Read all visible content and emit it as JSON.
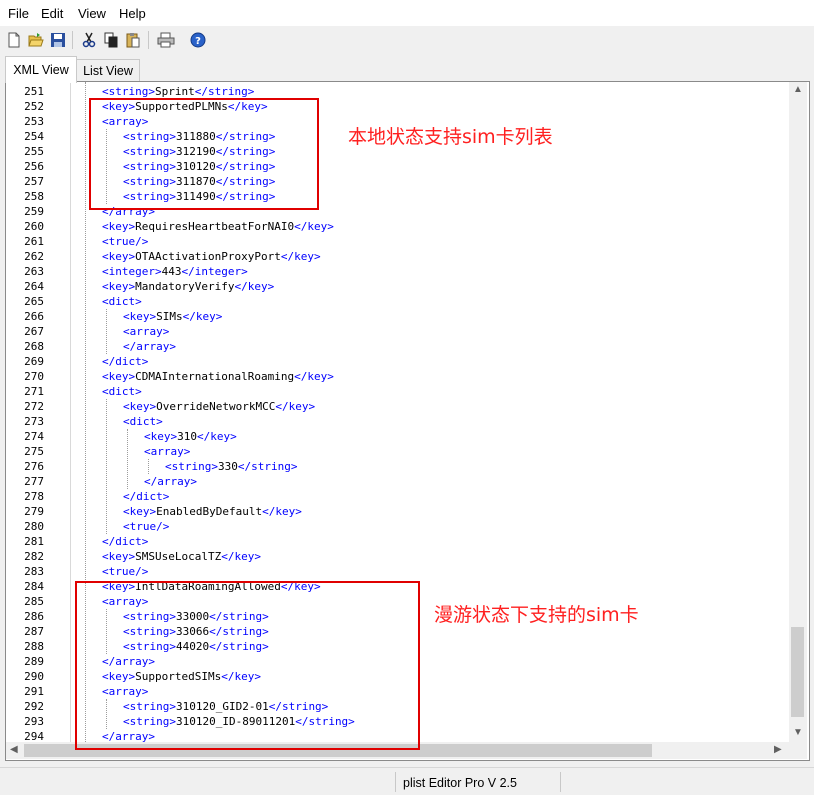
{
  "menu": [
    "File",
    "Edit",
    "View",
    "Help"
  ],
  "toolbar": {
    "icons": [
      "new-icon",
      "open-icon",
      "save-icon",
      "cut-icon",
      "copy-icon",
      "paste-icon",
      "print-icon",
      "help-icon"
    ]
  },
  "tabs": [
    {
      "label": "XML View",
      "active": true
    },
    {
      "label": "List View",
      "active": false
    }
  ],
  "editor": {
    "lines": [
      {
        "n": "251",
        "depth": 1,
        "code": "<string>Sprint</string>"
      },
      {
        "n": "252",
        "depth": 1,
        "code": "<key>SupportedPLMNs</key>"
      },
      {
        "n": "253",
        "depth": 1,
        "code": "<array>"
      },
      {
        "n": "254",
        "depth": 2,
        "code": "<string>311880</string>"
      },
      {
        "n": "255",
        "depth": 2,
        "code": "<string>312190</string>"
      },
      {
        "n": "256",
        "depth": 2,
        "code": "<string>310120</string>"
      },
      {
        "n": "257",
        "depth": 2,
        "code": "<string>311870</string>"
      },
      {
        "n": "258",
        "depth": 2,
        "code": "<string>311490</string>"
      },
      {
        "n": "259",
        "depth": 1,
        "code": "</array>"
      },
      {
        "n": "260",
        "depth": 1,
        "code": "<key>RequiresHeartbeatForNAI0</key>"
      },
      {
        "n": "261",
        "depth": 1,
        "code": "<true/>"
      },
      {
        "n": "262",
        "depth": 1,
        "code": "<key>OTAActivationProxyPort</key>"
      },
      {
        "n": "263",
        "depth": 1,
        "code": "<integer>443</integer>"
      },
      {
        "n": "264",
        "depth": 1,
        "code": "<key>MandatoryVerify</key>"
      },
      {
        "n": "265",
        "depth": 1,
        "code": "<dict>"
      },
      {
        "n": "266",
        "depth": 2,
        "code": "<key>SIMs</key>"
      },
      {
        "n": "267",
        "depth": 2,
        "code": "<array>"
      },
      {
        "n": "268",
        "depth": 2,
        "code": "</array>"
      },
      {
        "n": "269",
        "depth": 1,
        "code": "</dict>"
      },
      {
        "n": "270",
        "depth": 1,
        "code": "<key>CDMAInternationalRoaming</key>"
      },
      {
        "n": "271",
        "depth": 1,
        "code": "<dict>"
      },
      {
        "n": "272",
        "depth": 2,
        "code": "<key>OverrideNetworkMCC</key>"
      },
      {
        "n": "273",
        "depth": 2,
        "code": "<dict>"
      },
      {
        "n": "274",
        "depth": 3,
        "code": "<key>310</key>"
      },
      {
        "n": "275",
        "depth": 3,
        "code": "<array>"
      },
      {
        "n": "276",
        "depth": 4,
        "code": "<string>330</string>"
      },
      {
        "n": "277",
        "depth": 3,
        "code": "</array>"
      },
      {
        "n": "278",
        "depth": 2,
        "code": "</dict>"
      },
      {
        "n": "279",
        "depth": 2,
        "code": "<key>EnabledByDefault</key>"
      },
      {
        "n": "280",
        "depth": 2,
        "code": "<true/>"
      },
      {
        "n": "281",
        "depth": 1,
        "code": "</dict>"
      },
      {
        "n": "282",
        "depth": 1,
        "code": "<key>SMSUseLocalTZ</key>"
      },
      {
        "n": "283",
        "depth": 1,
        "code": "<true/>"
      },
      {
        "n": "284",
        "depth": 1,
        "code": "<key>IntlDataRoamingAllowed</key>"
      },
      {
        "n": "285",
        "depth": 1,
        "code": "<array>"
      },
      {
        "n": "286",
        "depth": 2,
        "code": "<string>33000</string>"
      },
      {
        "n": "287",
        "depth": 2,
        "code": "<string>33066</string>"
      },
      {
        "n": "288",
        "depth": 2,
        "code": "<string>44020</string>"
      },
      {
        "n": "289",
        "depth": 1,
        "code": "</array>"
      },
      {
        "n": "290",
        "depth": 1,
        "code": "<key>SupportedSIMs</key>"
      },
      {
        "n": "291",
        "depth": 1,
        "code": "<array>"
      },
      {
        "n": "292",
        "depth": 2,
        "code": "<string>310120_GID2-01</string>"
      },
      {
        "n": "293",
        "depth": 2,
        "code": "<string>310120_ID-89011201</string>"
      },
      {
        "n": "294",
        "depth": 1,
        "code": "</array>"
      }
    ]
  },
  "annotations": {
    "local": "本地状态支持sim卡列表",
    "roaming": "漫游状态下支持的sim卡"
  },
  "status": {
    "text": "plist Editor Pro V 2.5"
  },
  "colors": {
    "tag": "#0000ff",
    "annotation": "#e00000"
  }
}
